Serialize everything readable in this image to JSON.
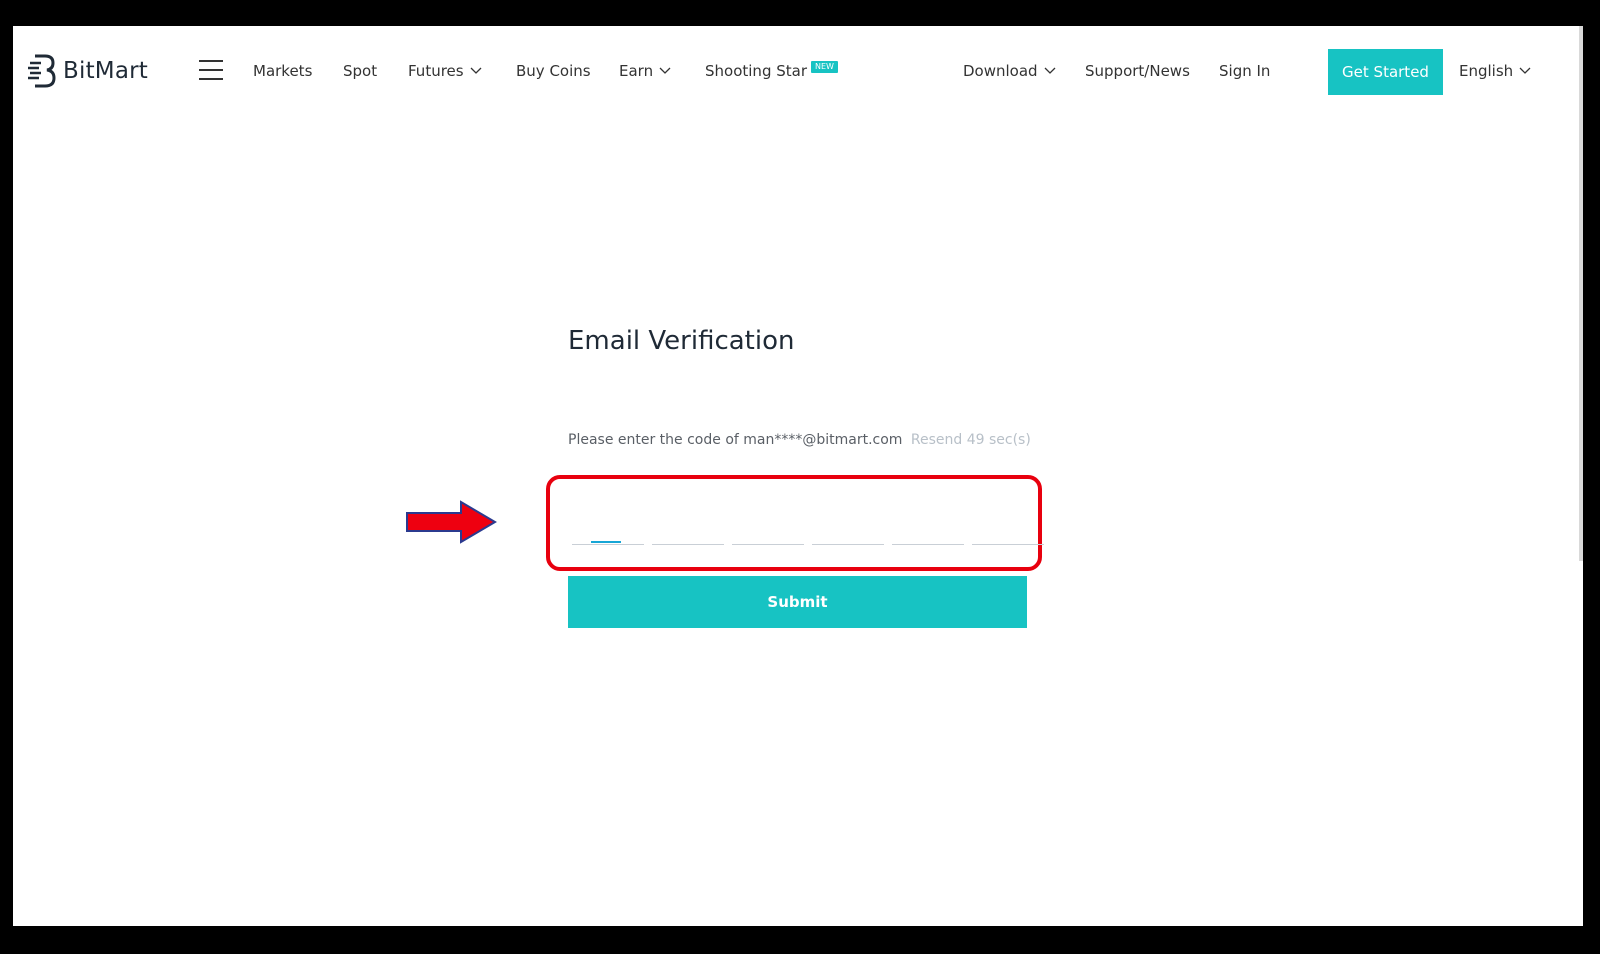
{
  "brand": {
    "name": "BitMart"
  },
  "nav": {
    "items": [
      {
        "label": "Markets"
      },
      {
        "label": "Spot"
      },
      {
        "label": "Futures"
      },
      {
        "label": "Buy Coins"
      },
      {
        "label": "Earn"
      },
      {
        "label": "Shooting Star",
        "badge": "NEW"
      }
    ],
    "right": {
      "download": "Download",
      "support": "Support/News",
      "sign_in": "Sign In",
      "get_started": "Get Started",
      "language": "English"
    }
  },
  "verification": {
    "title": "Email Verification",
    "prompt": "Please enter the code of man****@bitmart.com",
    "resend": "Resend 49 sec(s)",
    "code_cells": [
      "",
      "",
      "",
      "",
      "",
      ""
    ],
    "submit_label": "Submit"
  },
  "colors": {
    "accent": "#17c3c3",
    "highlight": "#e8000e",
    "text": "#1f2a36"
  },
  "icons": {
    "menu": "hamburger-icon",
    "dropdown": "chevron-down-icon",
    "annotation": "arrow-right-icon"
  }
}
